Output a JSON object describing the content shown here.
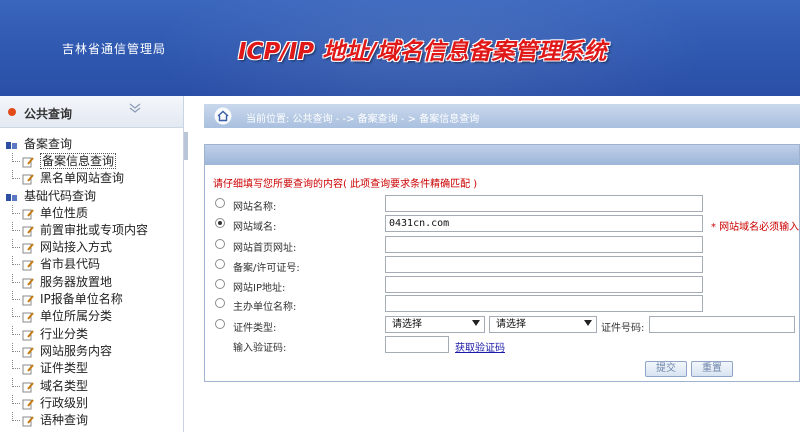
{
  "header": {
    "bureau": "吉林省通信管理局",
    "title": "ICP/IP 地址/域名信息备案管理系统"
  },
  "sidebar": {
    "title": "公共查询",
    "groups": [
      {
        "label": "备案查询",
        "items": [
          "备案信息查询",
          "黑名单网站查询"
        ]
      },
      {
        "label": "基础代码查询",
        "items": [
          "单位性质",
          "前置审批或专项内容",
          "网站接入方式",
          "省市县代码",
          "服务器放置地",
          "IP报备单位名称",
          "单位所属分类",
          "行业分类",
          "网站服务内容",
          "证件类型",
          "域名类型",
          "行政级别",
          "语种查询"
        ]
      }
    ]
  },
  "breadcrumb": {
    "text": "当前位置: 公共查询  - ->  备案查询  - > 备案信息查询"
  },
  "form": {
    "hint": "请仔细填写您所要查询的内容( 此项查询要求条件精确匹配 )",
    "fields": [
      {
        "label": "网站名称:",
        "value": "",
        "selected": false
      },
      {
        "label": "网站域名:",
        "value": "0431cn.com",
        "selected": true,
        "required_note": "* 网站域名必须输入"
      },
      {
        "label": "网站首页网址:",
        "value": "",
        "selected": false
      },
      {
        "label": "备案/许可证号:",
        "value": "",
        "selected": false
      },
      {
        "label": "网站IP地址:",
        "value": "",
        "selected": false
      },
      {
        "label": "主办单位名称:",
        "value": "",
        "selected": false
      }
    ],
    "cert": {
      "label": "证件类型:",
      "select1": "请选择",
      "select2": "请选择",
      "number_label": "证件号码:",
      "number_value": ""
    },
    "captcha": {
      "label": "输入验证码:",
      "value": "",
      "link": "获取验证码"
    },
    "buttons": {
      "submit": "提交",
      "reset": "重置"
    }
  },
  "colors": {
    "header_blue": "#2f58b0",
    "title_red": "#e01818",
    "hint_red": "#cc0000",
    "link_blue": "#1a1aa6"
  }
}
